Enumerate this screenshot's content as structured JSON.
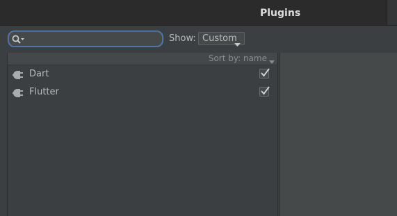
{
  "window": {
    "title": "Plugins"
  },
  "toolbar": {
    "search": {
      "value": "",
      "placeholder": ""
    },
    "show_label": "Show:",
    "show_select_value": "Custom"
  },
  "list": {
    "sort_label": "Sort by: name",
    "items": [
      {
        "name": "Dart",
        "enabled": true,
        "icon": "plug-icon"
      },
      {
        "name": "Flutter",
        "enabled": true,
        "icon": "plug-icon"
      }
    ]
  },
  "colors": {
    "background": "#3c3f41",
    "titlebar": "#2b2b2b",
    "search_border": "#5d84b5",
    "right_pane": "#45494a"
  }
}
